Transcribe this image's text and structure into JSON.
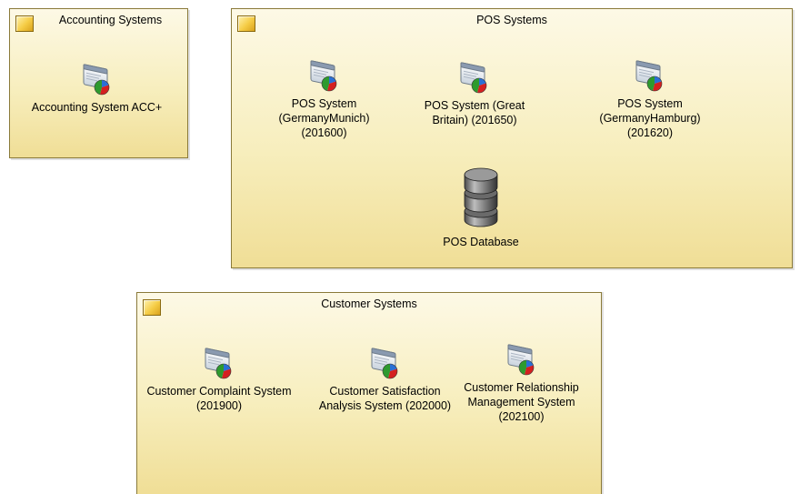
{
  "groups": {
    "accounting": {
      "title": "Accounting Systems",
      "nodes": [
        {
          "label": "Accounting System ACC+",
          "icon": "application-icon"
        }
      ]
    },
    "pos": {
      "title": "POS Systems",
      "nodes": [
        {
          "label": "POS System (GermanyMunich) (201600)",
          "icon": "application-icon"
        },
        {
          "label": "POS System (Great Britain) (201650)",
          "icon": "application-icon"
        },
        {
          "label": "POS System (GermanyHamburg) (201620)",
          "icon": "application-icon"
        },
        {
          "label": "POS Database",
          "icon": "database-icon"
        }
      ]
    },
    "customer": {
      "title": "Customer Systems",
      "nodes": [
        {
          "label": "Customer Complaint System (201900)",
          "icon": "application-icon"
        },
        {
          "label": "Customer Satisfaction Analysis System (202000)",
          "icon": "application-icon"
        },
        {
          "label": "Customer Relationship Management System (202100)",
          "icon": "application-icon"
        }
      ]
    }
  },
  "colors": {
    "group_fill_top": "#fdf9e6",
    "group_fill_bottom": "#f0de96",
    "group_border": "#8a7a3a",
    "group_icon": "#f5cc45",
    "pie_green": "#2e9a2e",
    "pie_red": "#d42020",
    "pie_blue": "#2a6fd6"
  }
}
